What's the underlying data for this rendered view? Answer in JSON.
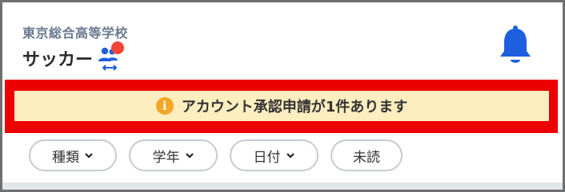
{
  "header": {
    "school_name": "東京総合高等学校",
    "team_name": "サッカー",
    "team_switch_icon": "people-swap-icon",
    "notification_icon": "bell-icon"
  },
  "alert": {
    "icon": "info-icon",
    "icon_glyph": "i",
    "message": "アカウント承認申請が1件あります"
  },
  "filters": [
    {
      "label": "種類",
      "has_dropdown": true
    },
    {
      "label": "学年",
      "has_dropdown": true
    },
    {
      "label": "日付",
      "has_dropdown": true
    },
    {
      "label": "未読",
      "has_dropdown": false
    }
  ],
  "colors": {
    "accent": "#1e5fe0",
    "alert_bg": "#fdeec0",
    "alert_highlight": "#ee0000",
    "badge": "#f44336"
  }
}
